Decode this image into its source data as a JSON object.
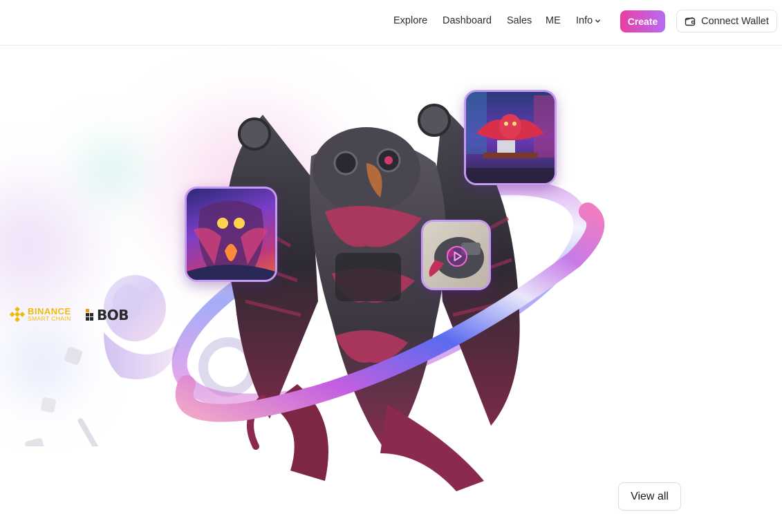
{
  "nav": {
    "links": [
      {
        "label": "Explore"
      },
      {
        "label": "Dashboard"
      },
      {
        "label": "Sales"
      },
      {
        "label": "ME"
      },
      {
        "label": "Info"
      }
    ],
    "info_icon": "chevron-down-icon",
    "create_label": "Create",
    "wallet_label": "Connect Wallet",
    "wallet_icon": "wallet-icon"
  },
  "partners": {
    "binance_line1": "BINANCE",
    "binance_line2": "SMART CHAIN",
    "bob_label": "BOB"
  },
  "colors": {
    "create_gradient_start": "#e93fa2",
    "create_gradient_end": "#b86bf2",
    "binance_gold": "#f0b90b",
    "thumb_border": "#c69af0"
  },
  "hero": {
    "play_icon": "play-icon"
  },
  "view_all_label": "View all"
}
